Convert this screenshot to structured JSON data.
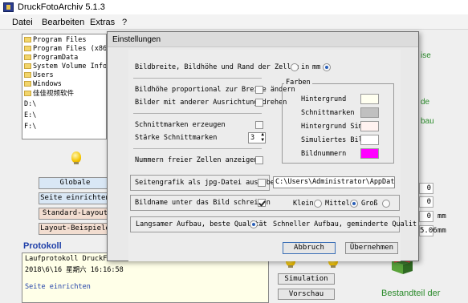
{
  "window": {
    "title": "DruckFotoArchiv  5.1.3"
  },
  "menu": [
    "Datei",
    "Bearbeiten",
    "Extras",
    "?"
  ],
  "tree": [
    "Program Files",
    "Program Files (x86)",
    "ProgramData",
    "System Volume Information",
    "Users",
    "Windows",
    "佳佳视频软件",
    "D:\\",
    "E:\\",
    "F:\\"
  ],
  "buttons": {
    "globale": "Globale",
    "seite_einrichten": "Seite einrichten",
    "standard_layout": "Standard-Layout",
    "layout_beispiele": "Layout-Beispiele",
    "simulation": "Simulation",
    "vorschau": "Vorschau"
  },
  "protokoll": {
    "label": "Protokoll",
    "lines": [
      "Laufprotokoll DruckFotoArchiv 5.1.3",
      "2018\\6\\16 星期六 16:16:58",
      "Seite einrichten"
    ]
  },
  "background_right": {
    "text1": "ise",
    "text2": "de",
    "text3": "bau",
    "numbers": [
      "0",
      "0",
      "0",
      "5.06"
    ],
    "units": [
      "mm",
      "mm"
    ],
    "bestandteil": "Bestandteil der"
  },
  "dialog": {
    "title": "Einstellungen",
    "row_units": {
      "label": "Bildbreite, Bildhöhe und Rand  der Zellen",
      "opt_in": "in",
      "opt_mm": "mm",
      "selected": "mm"
    },
    "row_prop": "Bildhöhe proportional zur Breite ändern",
    "row_drehen": "Bilder mit anderer Ausrichtung drehen",
    "row_schnitt": "Schnittmarken erzeugen",
    "row_staerke": {
      "label": "Stärke Schnittmarken",
      "value": "3"
    },
    "row_nummern": "Nummern freier Zellen anzeigen",
    "farben": {
      "title": "Farben",
      "items": [
        {
          "label": "Hintergrund",
          "color": "#fffff0"
        },
        {
          "label": "Schnittmarken",
          "color": "#c0c0c0"
        },
        {
          "label": "Hintergrund Sim.",
          "color": "#fff2f0"
        },
        {
          "label": "Simuliertes Bild",
          "color": "#ffffff"
        },
        {
          "label": "Bildnummern",
          "color": "#ff00ff"
        }
      ]
    },
    "row_jpg": {
      "label": "Seitengrafik als jpg-Datei ausgeben",
      "path": "C:\\Users\\Administrator\\AppData\\L"
    },
    "row_bildname": {
      "label": "Bildname unter das Bild schreiben",
      "opt_klein": "Klein",
      "opt_mittel": "Mittel",
      "opt_gross": "Groß",
      "selected": "Mittel"
    },
    "row_aufbau": {
      "opt_langsam": "Langsamer Aufbau, beste Qualität",
      "opt_schnell": "Schneller Aufbau, geminderte Qualit",
      "selected": "Langsam"
    },
    "abbruch": "Abbruch",
    "uebernehmen": "Übernehmen"
  },
  "colors": {
    "accent_blue": "#1f3fa8",
    "magenta": "#ff00ff"
  }
}
